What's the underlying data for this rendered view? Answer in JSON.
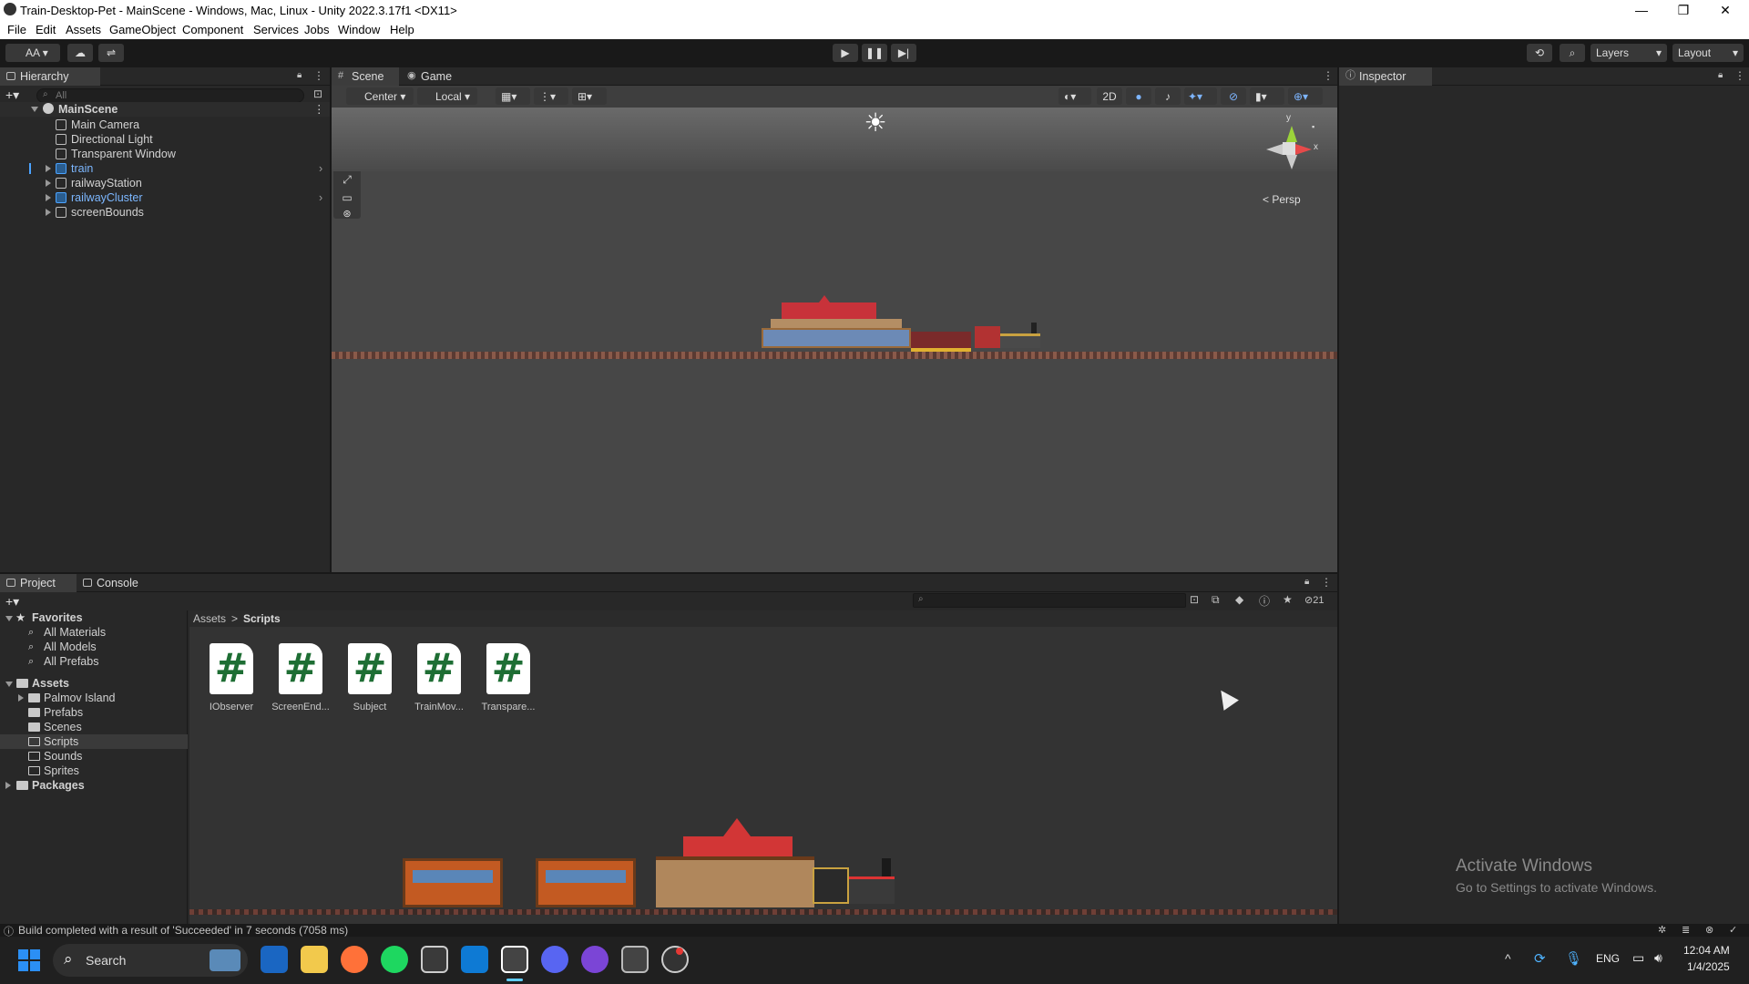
{
  "window": {
    "title": "Train-Desktop-Pet - MainScene - Windows, Mac, Linux - Unity 2022.3.17f1 <DX11>",
    "minimize": "—",
    "maximize": "❐",
    "close": "✕"
  },
  "menu": [
    "File",
    "Edit",
    "Assets",
    "GameObject",
    "Component",
    "Services",
    "Jobs",
    "Window",
    "Help"
  ],
  "toolbar": {
    "account": "AA",
    "layers": "Layers",
    "layout": "Layout"
  },
  "hierarchy": {
    "tab": "Hierarchy",
    "search_placeholder": "All",
    "scene": "MainScene",
    "items": [
      {
        "label": "Main Camera"
      },
      {
        "label": "Directional Light"
      },
      {
        "label": "Transparent Window"
      },
      {
        "label": "train"
      },
      {
        "label": "railwayStation"
      },
      {
        "label": "railwayCluster"
      },
      {
        "label": "screenBounds"
      }
    ]
  },
  "scene": {
    "tabs": [
      "Scene",
      "Game"
    ],
    "pivot": "Center",
    "space": "Local",
    "mode_2d": "2D",
    "persp": "< Persp",
    "gizmo_y": "y",
    "gizmo_x": "x"
  },
  "inspector": {
    "tab": "Inspector"
  },
  "project": {
    "tabs": [
      "Project",
      "Console"
    ],
    "hidden_count": "21",
    "breadcrumb_root": "Assets",
    "breadcrumb_sep": ">",
    "breadcrumb_current": "Scripts",
    "favorites_label": "Favorites",
    "favorites": [
      "All Materials",
      "All Models",
      "All Prefabs"
    ],
    "assets_label": "Assets",
    "folders": [
      "Palmov Island",
      "Prefabs",
      "Scenes",
      "Scripts",
      "Sounds",
      "Sprites"
    ],
    "packages_label": "Packages",
    "files": [
      "IObserver",
      "ScreenEnd...",
      "Subject",
      "TrainMov...",
      "Transpare..."
    ],
    "file_glyph": "#"
  },
  "status": {
    "message": "Build completed with a result of 'Succeeded' in 7 seconds (7058 ms)"
  },
  "watermark": {
    "line1": "Activate Windows",
    "line2": "Go to Settings to activate Windows."
  },
  "taskbar": {
    "search": "Search",
    "lang": "ENG",
    "time": "12:04 AM",
    "date": "1/4/2025"
  }
}
